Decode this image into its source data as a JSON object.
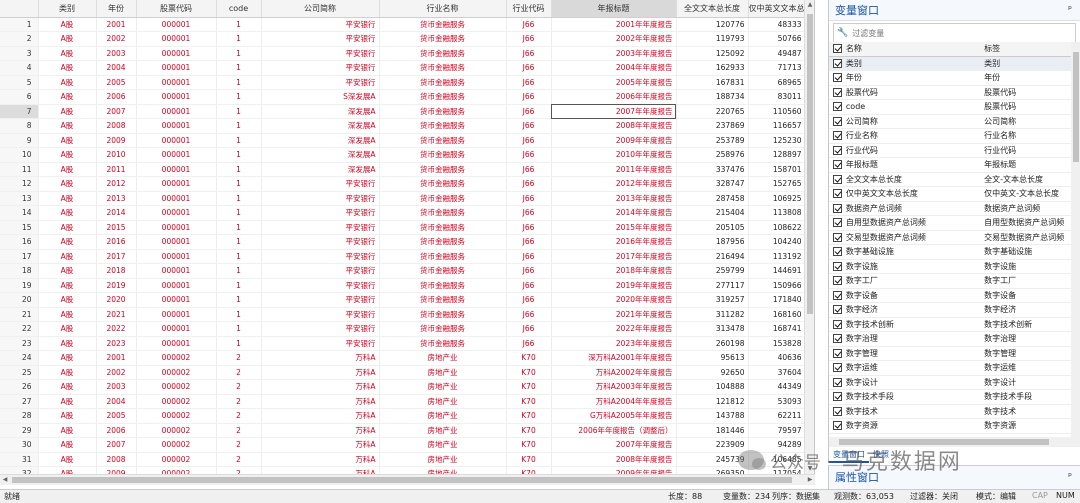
{
  "columns": [
    "",
    "类别",
    "年份",
    "股票代码",
    "code",
    "公司简称",
    "行业名称",
    "行业代码",
    "年报标题",
    "全文文本总长度",
    "仅中英文文本总长度"
  ],
  "rows": [
    [
      "1",
      "A股",
      "2001",
      "000001",
      "1",
      "平安银行",
      "货币金融服务",
      "J66",
      "2001年年度报告",
      "120776",
      "48333"
    ],
    [
      "2",
      "A股",
      "2002",
      "000001",
      "1",
      "平安银行",
      "货币金融服务",
      "J66",
      "2002年年度报告",
      "119793",
      "50766"
    ],
    [
      "3",
      "A股",
      "2003",
      "000001",
      "1",
      "平安银行",
      "货币金融服务",
      "J66",
      "2003年年度报告",
      "125092",
      "49487"
    ],
    [
      "4",
      "A股",
      "2004",
      "000001",
      "1",
      "平安银行",
      "货币金融服务",
      "J66",
      "2004年年度报告",
      "162933",
      "71713"
    ],
    [
      "5",
      "A股",
      "2005",
      "000001",
      "1",
      "平安银行",
      "货币金融服务",
      "J66",
      "2005年年度报告",
      "167831",
      "68965"
    ],
    [
      "6",
      "A股",
      "2006",
      "000001",
      "1",
      "S深发展A",
      "货币金融服务",
      "J66",
      "2006年年度报告",
      "188734",
      "83011"
    ],
    [
      "7",
      "A股",
      "2007",
      "000001",
      "1",
      "深发展A",
      "货币金融服务",
      "J66",
      "2007年年度报告",
      "220765",
      "110560"
    ],
    [
      "8",
      "A股",
      "2008",
      "000001",
      "1",
      "深发展A",
      "货币金融服务",
      "J66",
      "2008年年度报告",
      "237869",
      "116657"
    ],
    [
      "9",
      "A股",
      "2009",
      "000001",
      "1",
      "深发展A",
      "货币金融服务",
      "J66",
      "2009年年度报告",
      "253789",
      "125230"
    ],
    [
      "10",
      "A股",
      "2010",
      "000001",
      "1",
      "深发展A",
      "货币金融服务",
      "J66",
      "2010年年度报告",
      "258976",
      "128897"
    ],
    [
      "11",
      "A股",
      "2011",
      "000001",
      "1",
      "深发展A",
      "货币金融服务",
      "J66",
      "2011年年度报告",
      "337476",
      "158701"
    ],
    [
      "12",
      "A股",
      "2012",
      "000001",
      "1",
      "平安银行",
      "货币金融服务",
      "J66",
      "2012年年度报告",
      "328747",
      "152765"
    ],
    [
      "13",
      "A股",
      "2013",
      "000001",
      "1",
      "平安银行",
      "货币金融服务",
      "J66",
      "2013年年度报告",
      "287458",
      "106925"
    ],
    [
      "14",
      "A股",
      "2014",
      "000001",
      "1",
      "平安银行",
      "货币金融服务",
      "J66",
      "2014年年度报告",
      "215404",
      "113808"
    ],
    [
      "15",
      "A股",
      "2015",
      "000001",
      "1",
      "平安银行",
      "货币金融服务",
      "J66",
      "2015年年度报告",
      "205105",
      "108622"
    ],
    [
      "16",
      "A股",
      "2016",
      "000001",
      "1",
      "平安银行",
      "货币金融服务",
      "J66",
      "2016年年度报告",
      "187956",
      "104240"
    ],
    [
      "17",
      "A股",
      "2017",
      "000001",
      "1",
      "平安银行",
      "货币金融服务",
      "J66",
      "2017年年度报告",
      "216494",
      "113192"
    ],
    [
      "18",
      "A股",
      "2018",
      "000001",
      "1",
      "平安银行",
      "货币金融服务",
      "J66",
      "2018年年度报告",
      "259799",
      "144691"
    ],
    [
      "19",
      "A股",
      "2019",
      "000001",
      "1",
      "平安银行",
      "货币金融服务",
      "J66",
      "2019年年度报告",
      "277117",
      "150966"
    ],
    [
      "20",
      "A股",
      "2020",
      "000001",
      "1",
      "平安银行",
      "货币金融服务",
      "J66",
      "2020年年度报告",
      "319257",
      "171840"
    ],
    [
      "21",
      "A股",
      "2021",
      "000001",
      "1",
      "平安银行",
      "货币金融服务",
      "J66",
      "2021年年度报告",
      "311282",
      "168160"
    ],
    [
      "22",
      "A股",
      "2022",
      "000001",
      "1",
      "平安银行",
      "货币金融服务",
      "J66",
      "2022年年度报告",
      "313478",
      "168741"
    ],
    [
      "23",
      "A股",
      "2023",
      "000001",
      "1",
      "平安银行",
      "货币金融服务",
      "J66",
      "2023年年度报告",
      "260198",
      "153828"
    ],
    [
      "24",
      "A股",
      "2001",
      "000002",
      "2",
      "万科A",
      "房地产业",
      "K70",
      "深万科A2001年年度报告",
      "95613",
      "40636"
    ],
    [
      "25",
      "A股",
      "2002",
      "000002",
      "2",
      "万科A",
      "房地产业",
      "K70",
      "万科A2002年年度报告",
      "92650",
      "37604"
    ],
    [
      "26",
      "A股",
      "2003",
      "000002",
      "2",
      "万科A",
      "房地产业",
      "K70",
      "万科A2003年年度报告",
      "104888",
      "44349"
    ],
    [
      "27",
      "A股",
      "2004",
      "000002",
      "2",
      "万科A",
      "房地产业",
      "K70",
      "万科A2004年年度报告",
      "121812",
      "53093"
    ],
    [
      "28",
      "A股",
      "2005",
      "000002",
      "2",
      "万科A",
      "房地产业",
      "K70",
      "G万科A2005年年度报告",
      "143788",
      "62211"
    ],
    [
      "29",
      "A股",
      "2006",
      "000002",
      "2",
      "万科A",
      "房地产业",
      "K70",
      "2006年年度报告（调整后）",
      "181446",
      "79597"
    ],
    [
      "30",
      "A股",
      "2007",
      "000002",
      "2",
      "万科A",
      "房地产业",
      "K70",
      "2007年年度报告",
      "223909",
      "94289"
    ],
    [
      "31",
      "A股",
      "2008",
      "000002",
      "2",
      "万科A",
      "房地产业",
      "K70",
      "2008年年度报告",
      "245739",
      "106485"
    ],
    [
      "32",
      "A股",
      "2009",
      "000002",
      "2",
      "万科A",
      "房地产业",
      "K70",
      "2009年年度报告",
      "269350",
      "117054"
    ]
  ],
  "selected_row": "7",
  "var_panel": {
    "title": "变量窗口",
    "pin": "ᵖ",
    "filter_placeholder": "过滤变量",
    "header": {
      "name": "名称",
      "label": "标签"
    },
    "vars": [
      {
        "name": "类别",
        "label": "类别"
      },
      {
        "name": "年份",
        "label": "年份"
      },
      {
        "name": "股票代码",
        "label": "股票代码"
      },
      {
        "name": "code",
        "label": "股票代码"
      },
      {
        "name": "公司简称",
        "label": "公司简称"
      },
      {
        "name": "行业名称",
        "label": "行业名称"
      },
      {
        "name": "行业代码",
        "label": "行业代码"
      },
      {
        "name": "年报标题",
        "label": "年报标题"
      },
      {
        "name": "全文文本总长度",
        "label": "全文-文本总长度"
      },
      {
        "name": "仅中英文文本总长度",
        "label": "仅中英文-文本总长度"
      },
      {
        "name": "数据资产总词频",
        "label": "数据资产总词频"
      },
      {
        "name": "自用型数据资产总词频",
        "label": "自用型数据资产总词频"
      },
      {
        "name": "交易型数据资产总词频",
        "label": "交易型数据资产总词频"
      },
      {
        "name": "数字基础设施",
        "label": "数字基础设施"
      },
      {
        "name": "数字设施",
        "label": "数字设施"
      },
      {
        "name": "数字工厂",
        "label": "数字工厂"
      },
      {
        "name": "数字设备",
        "label": "数字设备"
      },
      {
        "name": "数字经济",
        "label": "数字经济"
      },
      {
        "name": "数字技术创新",
        "label": "数字技术创新"
      },
      {
        "name": "数字治理",
        "label": "数字治理"
      },
      {
        "name": "数字管理",
        "label": "数字管理"
      },
      {
        "name": "数字运维",
        "label": "数字运维"
      },
      {
        "name": "数字设计",
        "label": "数字设计"
      },
      {
        "name": "数字技术手段",
        "label": "数字技术手段"
      },
      {
        "name": "数字技术",
        "label": "数字技术"
      },
      {
        "name": "数字资源",
        "label": "数字资源"
      }
    ],
    "tabs": [
      "变量窗口",
      "快照"
    ]
  },
  "prop_panel": {
    "title": "属性窗口",
    "pin": "ᵖ"
  },
  "watermark": {
    "text1": "公众号 ·",
    "text2": "马克数据网"
  },
  "status": {
    "ready": "就绪",
    "length": "长度：88",
    "varcount": "变量数：234",
    "order": "列序：数据集",
    "obs": "观测数：63,053",
    "filter": "过滤器：关闭",
    "mode": "模式：编辑",
    "cap": "CAP",
    "num": "NUM"
  }
}
